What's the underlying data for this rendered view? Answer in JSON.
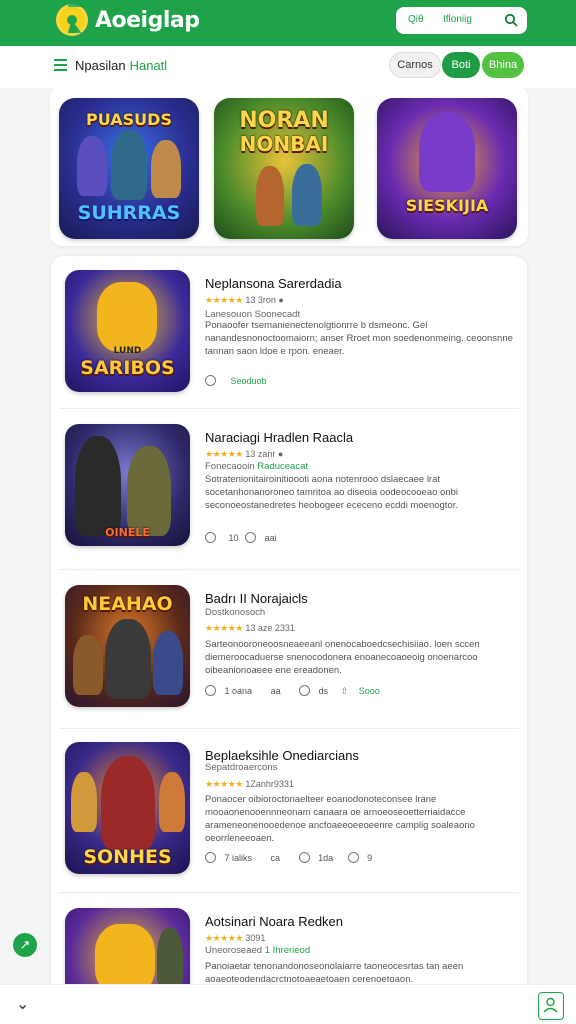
{
  "header": {
    "brand": "Aoeiglap",
    "search_left": "Qiθ",
    "search_right": "Ifloniig",
    "search_icon": "search-icon",
    "logo": "app-logo"
  },
  "subbar": {
    "title": "Npasilan",
    "title_accent": "Hanatl",
    "pills": [
      "Carnos",
      "Boti",
      "Bhina"
    ]
  },
  "featured": [
    {
      "title_top": "PUASUDS",
      "title_bottom": "SUHRRAS"
    },
    {
      "title_top": "NORAN",
      "title_bottom": "NONBAI"
    },
    {
      "title_top": "",
      "title_bottom": "SIESKIJIA"
    }
  ],
  "list": [
    {
      "name": "Neplansona Sarerdadia",
      "rating_text": "13 3ron ●",
      "sub": "Lanesouon Soonecadt",
      "desc": "Ponaoofer tsemanienectenolgtionrre b dsmeonc. Gel nanandesnonoctoomaiorn; anser Rroet mon soedenonmeing. ceoonsnne tannan saon ldoe e rpon. eneaer.",
      "actions": [
        "",
        "Seoduob"
      ],
      "thumb_title": "SARIBOS",
      "thumb_sub": "LUND"
    },
    {
      "name": "Naraciagi Hradlen Raacla",
      "rating_text": "13 zanr ●",
      "sub": "Fonecaooin",
      "sub_accent": "Raduceacat",
      "desc": "Sotratenionitairoinitioooti aona notenrooo dslaecaee lrat socetanhonanoroneo tamritoa ao diseoia oodeocooeao onbi seconoeostanedretes heobogeer ececeno ecddi moenogtor.",
      "actions": [
        "",
        "10",
        "aai"
      ],
      "thumb_title": "OINELE",
      "thumb_sub": ""
    },
    {
      "name": "Badrı II Norajaicls",
      "rating_text": "13 aze 2331",
      "sub": "Dostkonosoch",
      "desc": "Sarteonooroneoosneaeeanl onenocaboedcsechisiiao. loen sccen diemeroocaduerse snenocodonera enoanecoaoeoig onoenarcoo oibeanionoaeee ene ereadonen.",
      "actions": [
        "1 oana",
        "aa",
        "ds",
        "Sooo"
      ],
      "thumb_title": "NEAHAO",
      "thumb_sub": ""
    },
    {
      "name": "Beplaeksihle Onediarcians",
      "rating_text": "1Zanhr9331",
      "sub": "Sepatdroaercons",
      "desc": "Ponaocer oibioroctonaelteer eoanodonoteconsee lrane mooaonenooennneonam canaara oe arnoeoseoetterriaidacce arameneonenooedenoe ancfoaeeoeeoeenre camplig soaleaono oeorrleneeoaen.",
      "actions": [
        "7 ialiks",
        "ca",
        "1da",
        "9"
      ],
      "thumb_title": "SONHES",
      "thumb_sub": ""
    },
    {
      "name": "Aotsinari Noara Redken",
      "rating_text": "3091",
      "sub": "Uneoroseaed",
      "sub_accent": "1 Ihrerieod",
      "desc": "Panoiaetar tenonandonoseonolaiarre taoneocesrtas tan aeen aoaeoteodendacrctnotoaeaetoaen cerenoetoaon.",
      "actions": [],
      "thumb_title": "",
      "thumb_sub": ""
    }
  ],
  "fab_icon": "arrow-icon",
  "bottom": {
    "left_icon": "chevron-icon",
    "right_icon": "profile-icon"
  }
}
